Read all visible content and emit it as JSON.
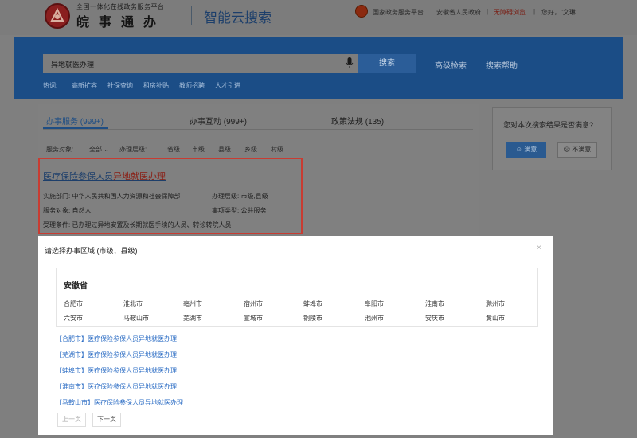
{
  "header": {
    "logo_subtitle": "全国一体化在线政务服务平台",
    "logo_title": "皖事通办",
    "search_title": "智能云搜索",
    "links": {
      "gov_platform": "国家政务服务平台",
      "province": "安徽省人民政府",
      "accessible": "无障碍浏览",
      "greeting": "您好，\"文琳"
    }
  },
  "search": {
    "query": "异地就医办理",
    "button": "搜索",
    "advanced": "高级检索",
    "help": "搜索帮助",
    "hot_label": "热词:",
    "hot_terms": [
      "高新扩容",
      "社保查询",
      "租房补贴",
      "教师招聘",
      "人才引进"
    ]
  },
  "tabs": [
    {
      "label": "办事服务 (999+)"
    },
    {
      "label": "办事互动 (999+)"
    },
    {
      "label": "政策法规 (135)"
    }
  ],
  "filters": {
    "object_label": "服务对象:",
    "object_value": "全部",
    "level_label": "办理层级:",
    "levels": [
      "省级",
      "市级",
      "县级",
      "乡级",
      "村级"
    ]
  },
  "result": {
    "title_prefix": "医疗保险参保人员",
    "title_highlight": "异地就医办理",
    "dept_label": "实施部门:",
    "dept_value": "中华人民共和国人力资源和社会保障部",
    "level_label": "办理层级:",
    "level_value": "市级,县级",
    "target_label": "服务对象:",
    "target_value": "自然人",
    "type_label": "事项类型:",
    "type_value": "公共服务",
    "cond_label": "受理条件:",
    "cond_value": "已办理过异地安置及长期就医手续的人员、转诊转院人员"
  },
  "survey": {
    "question": "您对本次搜索结果是否满意?",
    "satisfied": "满意",
    "unsatisfied": "不满意"
  },
  "modal": {
    "title": "请选择办事区域 (市级、县级)",
    "close": "×",
    "province": "安徽省",
    "cities_row1": [
      "合肥市",
      "淮北市",
      "亳州市",
      "宿州市",
      "蚌埠市",
      "阜阳市",
      "淮南市",
      "滁州市"
    ],
    "cities_row2": [
      "六安市",
      "马鞍山市",
      "芜湖市",
      "宣城市",
      "铜陵市",
      "池州市",
      "安庆市",
      "黄山市"
    ],
    "links": [
      "【合肥市】医疗保险参保人员异地就医办理",
      "【芜湖市】医疗保险参保人员异地就医办理",
      "【蚌埠市】医疗保险参保人员异地就医办理",
      "【淮南市】医疗保险参保人员异地就医办理",
      "【马鞍山市】医疗保险参保人员异地就医办理"
    ],
    "prev": "上一页",
    "next": "下一页"
  }
}
